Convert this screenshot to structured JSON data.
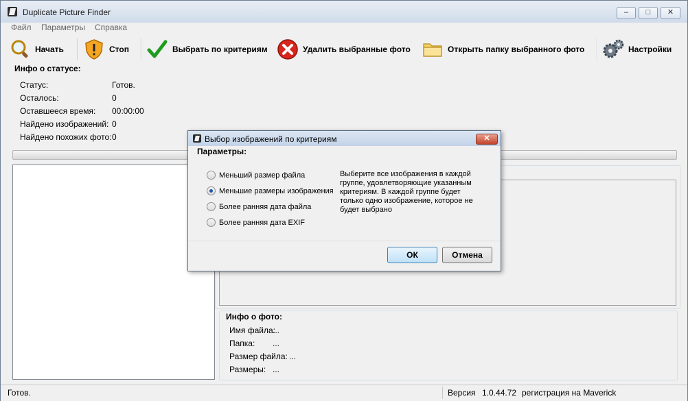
{
  "window": {
    "title": "Duplicate Picture Finder",
    "minimize": "–",
    "maximize": "□",
    "close": "✕"
  },
  "menu": [
    "Файл",
    "Параметры",
    "Справка"
  ],
  "toolbar": {
    "start": "Начать",
    "stop": "Стоп",
    "select": "Выбрать по критериям",
    "delete": "Удалить выбранные фото",
    "open_folder": "Открыть папку выбранного фото",
    "settings": "Настройки"
  },
  "status_info": {
    "title": "Инфо о статусе:",
    "rows": [
      {
        "label": "Статус:",
        "value": "Готов."
      },
      {
        "label": "Осталось:",
        "value": "0"
      },
      {
        "label": "Оставшееся время:",
        "value": "00:00:00"
      },
      {
        "label": "Найдено изображений:",
        "value": "0"
      },
      {
        "label": "Найдено похожих фото:",
        "value": "0"
      }
    ]
  },
  "photo_info": {
    "title": "Инфо о фото:",
    "rows": [
      {
        "label": "Имя файла:",
        "value": "..."
      },
      {
        "label": "Папка:",
        "value": "..."
      },
      {
        "label": "Размер файла:",
        "value": "..."
      },
      {
        "label": "Размеры:",
        "value": "..."
      }
    ]
  },
  "statusbar": {
    "status": "Готов.",
    "version_label": "Версия",
    "version": "1.0.44.72",
    "registration": "регистрация на Maverick"
  },
  "dialog": {
    "title": "Выбор изображений по критериям",
    "close": "✕",
    "group_title": "Параметры:",
    "options": [
      {
        "label": "Меньший размер файла",
        "selected": false
      },
      {
        "label": "Меньшие размеры изображения",
        "selected": true
      },
      {
        "label": "Более ранняя дата файла",
        "selected": false
      },
      {
        "label": "Более ранняя дата EXIF",
        "selected": false
      }
    ],
    "description": "Выберите все изображения в каждой группе, удовлетворяющие указанным критериям. В каждой группе будет только одно изображение, которое не будет выбрано",
    "ok": "ОК",
    "cancel": "Отмена"
  }
}
